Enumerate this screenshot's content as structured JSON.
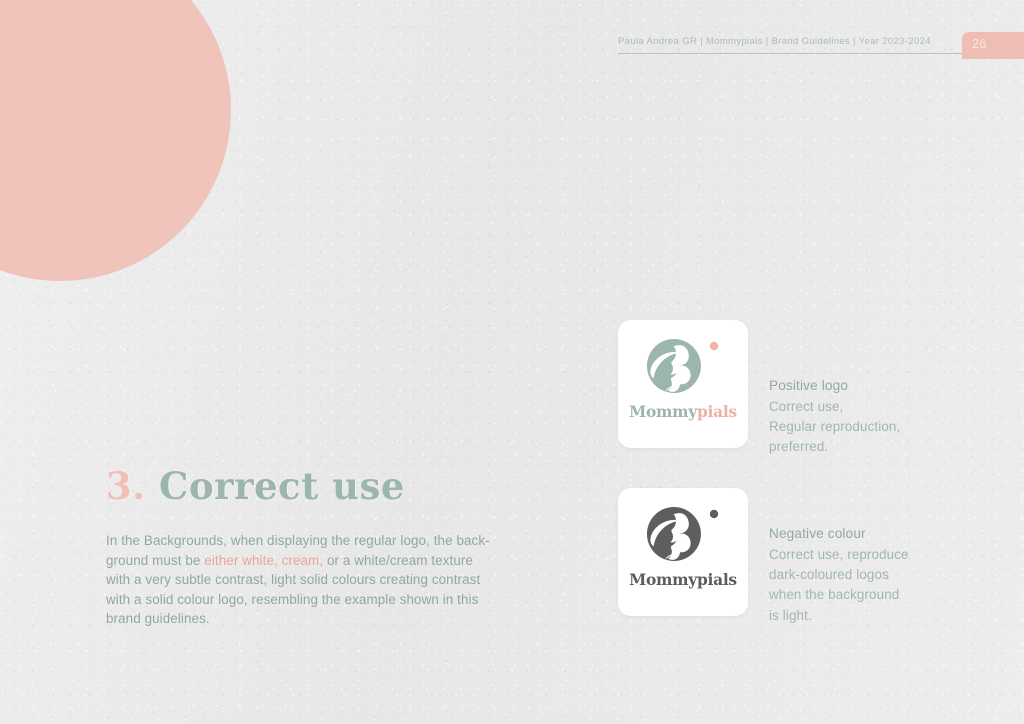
{
  "header": {
    "meta_line": "Paula Andrea GR  |  Mommypials  |  Brand Guidelines  |  Year 2023-2024",
    "page_number": "26"
  },
  "section": {
    "number": "3.",
    "title": "Correct use",
    "body_part1": "In the Backgrounds, when displaying the regular logo, the back-ground must be ",
    "body_highlight": "either white, cream,",
    "body_part2": " or a white/cream texture with a very subtle contrast, light solid colours creating contrast with a solid colour logo, resembling the example shown in this brand guidelines."
  },
  "usage": [
    {
      "id": "positive",
      "heading": "Positive logo",
      "desc_lines": [
        "Correct use,",
        "Regular reproduction,",
        "preferred."
      ],
      "logo": {
        "word_first": "Mommy",
        "word_second": "pials",
        "disc_color": "#9cb5ad",
        "dot_color": "#f0b3a8"
      }
    },
    {
      "id": "negative",
      "heading": "Negative colour",
      "desc_lines": [
        "Correct use, reproduce",
        "dark-coloured logos",
        "when the background",
        "is light."
      ],
      "logo": {
        "word_first": "Mommy",
        "word_second": "pials",
        "disc_color": "#5e5e5e",
        "dot_color": "#5e5e5e"
      }
    }
  ],
  "colors": {
    "page_background": "#eaeaea",
    "sage": "#9cb5ad",
    "pink": "#f0bdb5",
    "text_sage": "#8fa8a1",
    "dark": "#5e5e5e"
  }
}
